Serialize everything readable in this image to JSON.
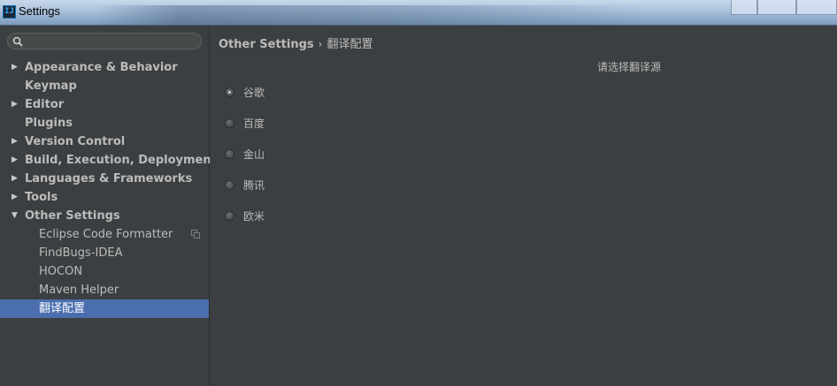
{
  "window": {
    "title": "Settings",
    "app_icon_text": "IJ"
  },
  "sidebar": {
    "search": {
      "value": "",
      "placeholder": ""
    },
    "items": [
      {
        "label": "Appearance & Behavior",
        "arrow": "▶",
        "level": 0,
        "expanded": false
      },
      {
        "label": "Keymap",
        "arrow": "",
        "level": 0
      },
      {
        "label": "Editor",
        "arrow": "▶",
        "level": 0,
        "expanded": false
      },
      {
        "label": "Plugins",
        "arrow": "",
        "level": 0
      },
      {
        "label": "Version Control",
        "arrow": "▶",
        "level": 0,
        "expanded": false
      },
      {
        "label": "Build, Execution, Deployment",
        "arrow": "▶",
        "level": 0,
        "expanded": false
      },
      {
        "label": "Languages & Frameworks",
        "arrow": "▶",
        "level": 0,
        "expanded": false
      },
      {
        "label": "Tools",
        "arrow": "▶",
        "level": 0,
        "expanded": false
      },
      {
        "label": "Other Settings",
        "arrow": "▼",
        "level": 0,
        "expanded": true
      },
      {
        "label": "Eclipse Code Formatter",
        "level": 1,
        "icon": "copy-icon"
      },
      {
        "label": "FindBugs-IDEA",
        "level": 1
      },
      {
        "label": "HOCON",
        "level": 1
      },
      {
        "label": "Maven Helper",
        "level": 1
      },
      {
        "label": "翻译配置",
        "level": 1,
        "selected": true
      }
    ]
  },
  "content": {
    "breadcrumb": {
      "parent": "Other Settings",
      "separator": "›",
      "current": "翻译配置"
    },
    "section_title": "请选择翻译源",
    "options": [
      {
        "label": "谷歌",
        "checked": true
      },
      {
        "label": "百度",
        "checked": false
      },
      {
        "label": "金山",
        "checked": false
      },
      {
        "label": "腾讯",
        "checked": false
      },
      {
        "label": "欧米",
        "checked": false
      }
    ]
  },
  "colors": {
    "background": "#3c3f41",
    "text": "#bbbbbb",
    "selection": "#4b6eaf"
  }
}
